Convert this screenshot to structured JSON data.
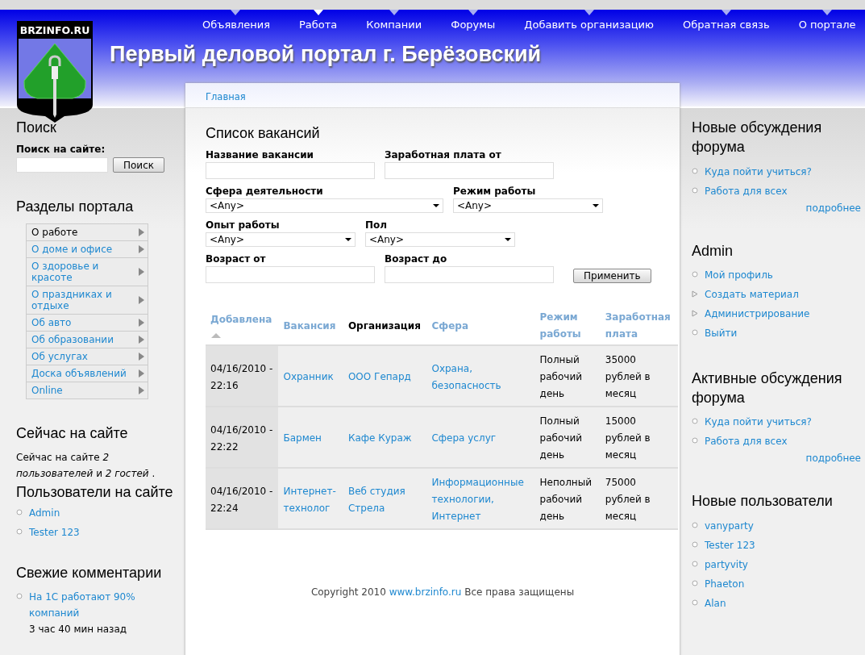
{
  "logo": {
    "text": "BRZINFO.RU"
  },
  "nav": [
    {
      "label": "Объявления",
      "selected": false
    },
    {
      "label": "Работа",
      "selected": true
    },
    {
      "label": "Компании",
      "selected": false
    },
    {
      "label": "Форумы",
      "selected": false
    },
    {
      "label": "Добавить организацию",
      "selected": false
    },
    {
      "label": "Обратная связь",
      "selected": false
    },
    {
      "label": "О портале",
      "selected": false
    }
  ],
  "site_title": "Первый деловой портал г. Берёзовский",
  "left": {
    "search": {
      "title": "Поиск",
      "label": "Поиск на сайте:",
      "button": "Поиск"
    },
    "sections": {
      "title": "Разделы портала",
      "items": [
        {
          "label": "О работе",
          "selected": true
        },
        {
          "label": "О доме и офисе",
          "selected": false
        },
        {
          "label": "О здоровье и красоте",
          "selected": false
        },
        {
          "label": "О праздниках и отдыхе",
          "selected": false
        },
        {
          "label": "Об авто",
          "selected": false
        },
        {
          "label": "Об образовании",
          "selected": false
        },
        {
          "label": "Об услугах",
          "selected": false
        },
        {
          "label": "Доска объявлений",
          "selected": false
        },
        {
          "label": "Online",
          "selected": false
        }
      ]
    },
    "online": {
      "title": "Сейчас на сайте",
      "text": "Сейчас на сайте *2 пользователей* и *2 гостей* .",
      "subtitle": "Пользователи на сайте",
      "users": [
        "Admin",
        "Tester 123"
      ]
    },
    "comments": {
      "title": "Свежие комментарии",
      "items": [
        {
          "link": "На 1С работают 90% компаний",
          "time": "3 час 40 мин назад"
        }
      ]
    }
  },
  "breadcrumb": "Главная",
  "filter": {
    "title": "Список вакансий",
    "rows": [
      [
        {
          "kind": "text",
          "label": "Название вакансии"
        },
        {
          "kind": "text",
          "label": "Заработная плата от"
        }
      ],
      [
        {
          "kind": "select",
          "label": "Сфера деятельности",
          "value": "<Any>"
        },
        {
          "kind": "select",
          "label": "Режим работы",
          "value": "<Any>"
        }
      ],
      [
        {
          "kind": "select",
          "label": "Опыт работы",
          "value": "<Any>"
        },
        {
          "kind": "select",
          "label": "Пол",
          "value": "<Any>"
        }
      ],
      [
        {
          "kind": "text",
          "label": "Возраст от"
        },
        {
          "kind": "text",
          "label": "Возраст до"
        },
        {
          "kind": "button",
          "label": "Применить"
        }
      ]
    ]
  },
  "table": {
    "columns": [
      {
        "label": "Добавлена",
        "sorted": true,
        "emphasized": false,
        "link": false
      },
      {
        "label": "Вакансия",
        "sorted": false,
        "emphasized": false,
        "link": true
      },
      {
        "label": "Организация",
        "sorted": false,
        "emphasized": true,
        "link": true
      },
      {
        "label": "Сфера",
        "sorted": false,
        "emphasized": false,
        "link": true
      },
      {
        "label": "Режим работы",
        "sorted": false,
        "emphasized": false,
        "link": false
      },
      {
        "label": "Заработная плата",
        "sorted": false,
        "emphasized": false,
        "link": false
      }
    ],
    "rows": [
      [
        "04/16/2010 - 22:16",
        "Охранник",
        "ООО Гепард",
        "Охрана, безопасность",
        "Полный рабочий день",
        "35000 рублей в месяц"
      ],
      [
        "04/16/2010 - 22:22",
        "Бармен",
        "Кафе Кураж",
        "Сфера услуг",
        "Полный рабочий день",
        "15000 рублей в месяц"
      ],
      [
        "04/16/2010 - 22:24",
        "Интернет-технолог",
        "Веб студия Стрела",
        "Информационные технологии, Интернет",
        "Неполный рабочий день",
        "75000 рублей в месяц"
      ]
    ]
  },
  "footer": {
    "before": "Copyright 2010",
    "link": "www.brzinfo.ru",
    "after": "Все права защищены"
  },
  "right": [
    {
      "title": "Новые обсуждения форума",
      "items": [
        {
          "label": "Куда пойти учиться?",
          "kind": "leaf"
        },
        {
          "label": "Работа для всех",
          "kind": "leaf"
        }
      ],
      "more": "подробнее"
    },
    {
      "title": "Admin",
      "items": [
        {
          "label": "Мой профиль",
          "kind": "leaf"
        },
        {
          "label": "Создать материал",
          "kind": "collapsed"
        },
        {
          "label": "Администрирование",
          "kind": "collapsed"
        },
        {
          "label": "Выйти",
          "kind": "leaf"
        }
      ]
    },
    {
      "title": "Активные обсуждения форума",
      "items": [
        {
          "label": "Куда пойти учиться?",
          "kind": "leaf"
        },
        {
          "label": "Работа для всех",
          "kind": "leaf"
        }
      ],
      "more": "подробнее"
    },
    {
      "title": "Новые пользователи",
      "items": [
        {
          "label": "vanyparty",
          "kind": "leaf"
        },
        {
          "label": "Tester 123",
          "kind": "leaf"
        },
        {
          "label": "partyvity",
          "kind": "leaf"
        },
        {
          "label": "Phaeton",
          "kind": "leaf"
        },
        {
          "label": "Alan",
          "kind": "leaf"
        }
      ]
    }
  ]
}
